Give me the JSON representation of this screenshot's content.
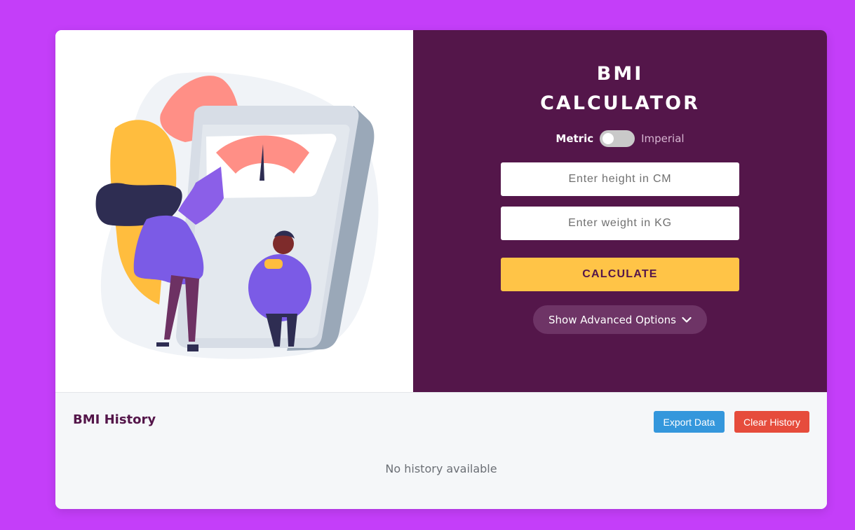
{
  "calculator": {
    "title_line1": "BMI",
    "title_line2": "CALCULATOR",
    "unit_toggle": {
      "metric_label": "Metric",
      "imperial_label": "Imperial",
      "selected": "Metric"
    },
    "height_input": {
      "placeholder": "Enter height in CM",
      "value": ""
    },
    "weight_input": {
      "placeholder": "Enter weight in KG",
      "value": ""
    },
    "calculate_label": "CALCULATE",
    "advanced_options_label": "Show Advanced Options",
    "advanced_options_icon": "chevron-down-icon"
  },
  "history": {
    "title": "BMI History",
    "export_label": "Export Data",
    "clear_label": "Clear History",
    "empty_message": "No history available"
  },
  "colors": {
    "page_background": "#c43ef9",
    "panel_background": "#54164a",
    "calculate_button": "#ffc447",
    "export_button": "#3497dc",
    "clear_button": "#e64c3c"
  },
  "illustration": {
    "subject": "weighing scale with two people"
  }
}
